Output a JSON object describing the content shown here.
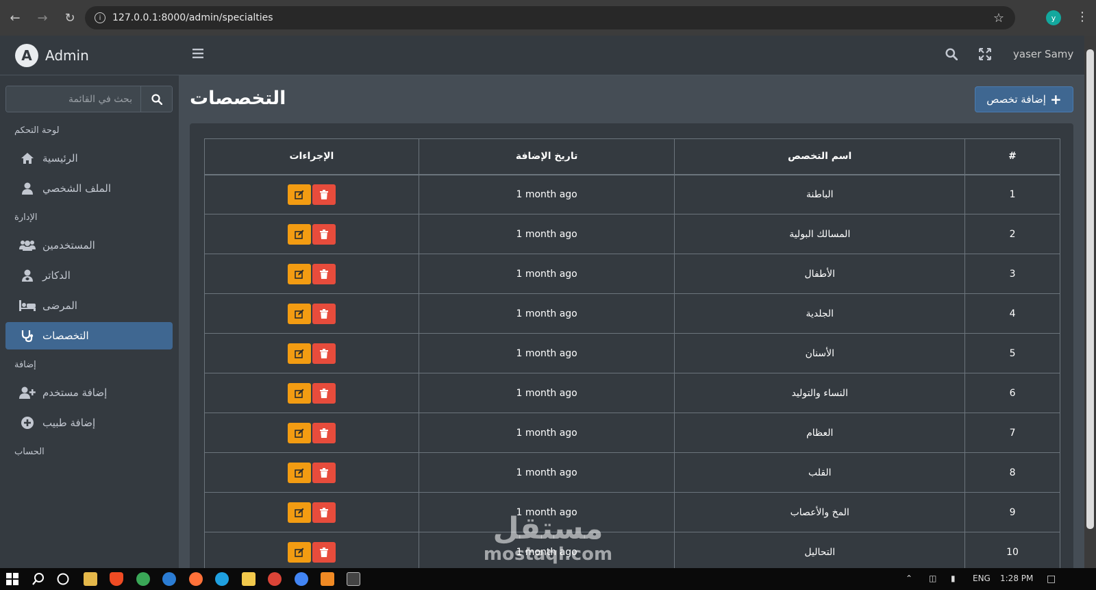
{
  "browser": {
    "url": "127.0.0.1:8000/admin/specialties",
    "profile_initial": "y"
  },
  "brand": {
    "name": "Admin"
  },
  "sidebar": {
    "search_placeholder": "بحث في القائمة",
    "sections": {
      "dashboard": "لوحة التحكم",
      "management": "الإدارة",
      "add": "إضافة",
      "account": "الحساب"
    },
    "items": {
      "home": "الرئيسية",
      "profile": "الملف الشخصي",
      "users": "المستخدمين",
      "doctors": "الدكاتر",
      "patients": "المرضى",
      "specialties": "التخصصات",
      "add_user": "إضافة مستخدم",
      "add_doctor": "إضافة طبيب"
    }
  },
  "topnav": {
    "user_name": "yaser Samy"
  },
  "page": {
    "title": "التخصصات",
    "add_button": "إضافة تخصص"
  },
  "table": {
    "headers": {
      "index": "#",
      "name": "اسم التخصص",
      "date": "تاريخ الإضافة",
      "actions": "الإجراءات"
    },
    "rows": [
      {
        "index": "1",
        "name": "الباطنة",
        "date": "1 month ago"
      },
      {
        "index": "2",
        "name": "المسالك البولية",
        "date": "1 month ago"
      },
      {
        "index": "3",
        "name": "الأطفال",
        "date": "1 month ago"
      },
      {
        "index": "4",
        "name": "الجلدية",
        "date": "1 month ago"
      },
      {
        "index": "5",
        "name": "الأسنان",
        "date": "1 month ago"
      },
      {
        "index": "6",
        "name": "النساء والتوليد",
        "date": "1 month ago"
      },
      {
        "index": "7",
        "name": "العظام",
        "date": "1 month ago"
      },
      {
        "index": "8",
        "name": "القلب",
        "date": "1 month ago"
      },
      {
        "index": "9",
        "name": "المخ والأعصاب",
        "date": "1 month ago"
      },
      {
        "index": "10",
        "name": "التحاليل",
        "date": "1 month ago"
      }
    ]
  },
  "watermark": {
    "arabic": "مستقل",
    "latin": "mostaql.com"
  },
  "taskbar": {
    "language": "ENG",
    "time": "1:28 PM"
  },
  "colors": {
    "edit": "#f39c12",
    "delete": "#e74c3c",
    "primary": "#3f6791"
  }
}
